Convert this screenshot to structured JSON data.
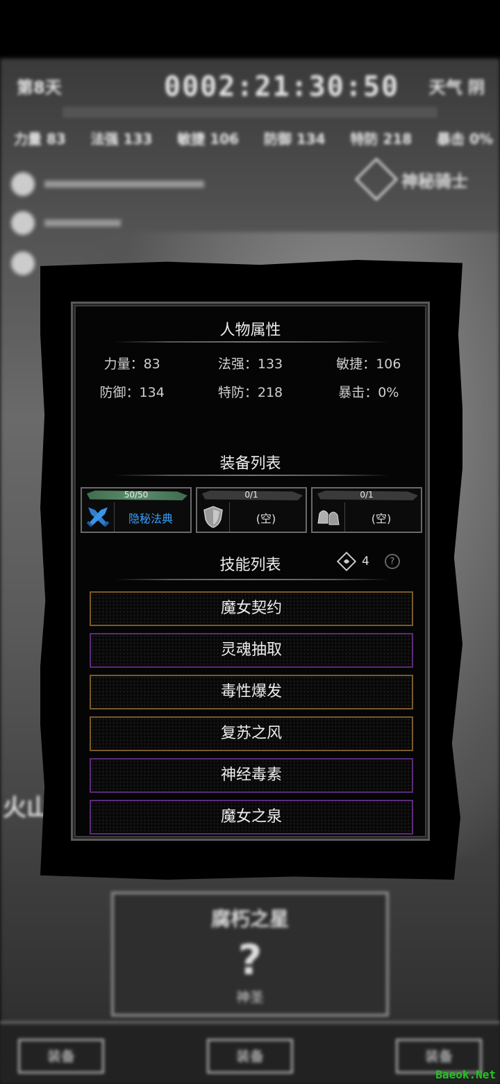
{
  "background": {
    "day_label": "第8天",
    "clock": "0002:21:30:50",
    "weather": "天气 阴",
    "stats": [
      "力量 83",
      "法强 133",
      "敏捷 106",
      "防御 134",
      "特防 218",
      "暴击 0%"
    ],
    "role": "神秘骑士",
    "bottom_card_title": "腐朽之星",
    "bottom_card_mark": "?",
    "bottom_card_sub": "神圣",
    "left_text": "火山",
    "buttons": [
      "装备",
      "装备",
      "装备"
    ]
  },
  "panel": {
    "attributes_title": "人物属性",
    "attributes": [
      {
        "label": "力量：",
        "value": "83"
      },
      {
        "label": "法强：",
        "value": "133"
      },
      {
        "label": "敏捷：",
        "value": "106"
      },
      {
        "label": "防御：",
        "value": "134"
      },
      {
        "label": "特防：",
        "value": "218"
      },
      {
        "label": "暴击：",
        "value": "0%"
      }
    ],
    "equipment_title": "装备列表",
    "equipment": [
      {
        "count": "50/50",
        "name": "隐秘法典",
        "icon": "crossed-swords-icon",
        "fill": 1.0
      },
      {
        "count": "0/1",
        "name": "(空)",
        "icon": "shield-icon",
        "fill": 0.0
      },
      {
        "count": "0/1",
        "name": "(空)",
        "icon": "boots-icon",
        "fill": 0.0
      }
    ],
    "skills_title": "技能列表",
    "skill_points": "4",
    "help_mark": "?",
    "skills": [
      {
        "name": "魔女契约",
        "rarity": "gold"
      },
      {
        "name": "灵魂抽取",
        "rarity": "purple"
      },
      {
        "name": "毒性爆发",
        "rarity": "gold"
      },
      {
        "name": "复苏之风",
        "rarity": "gold"
      },
      {
        "name": "神经毒素",
        "rarity": "purple"
      },
      {
        "name": "魔女之泉",
        "rarity": "purple"
      }
    ]
  },
  "colors": {
    "accent_blue": "#39a0ff",
    "gold_border": "#7a5a2a",
    "purple_border": "#5c2b7a",
    "hp_green": "#5c8e6c"
  },
  "watermark": "Baeok.Net"
}
